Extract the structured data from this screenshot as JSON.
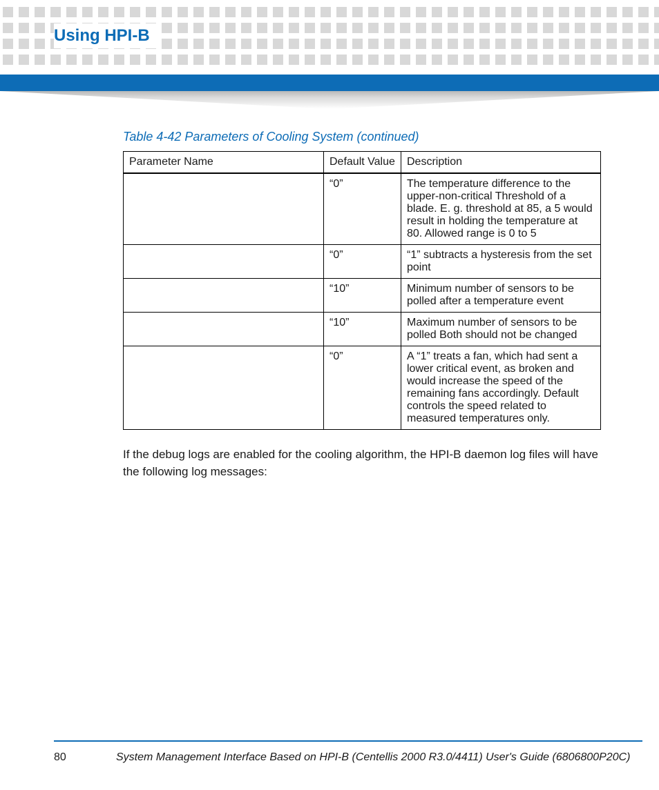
{
  "header": {
    "chapter_title": "Using HPI-B"
  },
  "table": {
    "caption": "Table 4-42 Parameters of Cooling System  (continued)",
    "columns": [
      "Parameter Name",
      "Default Value",
      "Description"
    ],
    "rows": [
      {
        "name": "",
        "default": "“0”",
        "desc": "The temperature difference to the upper-non-critical Threshold of a blade. E. g. threshold at 85, a 5 would result in holding the temperature at 80. Allowed range is 0 to 5"
      },
      {
        "name": "",
        "default": "“0”",
        "desc": "“1” subtracts a hysteresis from the set point"
      },
      {
        "name": "",
        "default": "“10”",
        "desc": "Minimum number of sensors to be polled after a temperature event"
      },
      {
        "name": "",
        "default": "“10”",
        "desc": "Maximum number of sensors to be polled Both should not be changed"
      },
      {
        "name": "",
        "default": "“0”",
        "desc": "A “1” treats a fan, which had sent a lower critical event, as broken and would increase the speed of the remaining fans accordingly. Default controls the speed related to measured temperatures only."
      }
    ]
  },
  "body": {
    "paragraph": "If the debug logs are enabled for the cooling algorithm, the HPI-B daemon log files will have the following log messages:"
  },
  "footer": {
    "page_number": "80",
    "doc_title": "System Management Interface Based on HPI-B (Centellis 2000 R3.0/4411) User's Guide (6806800P20C)"
  }
}
